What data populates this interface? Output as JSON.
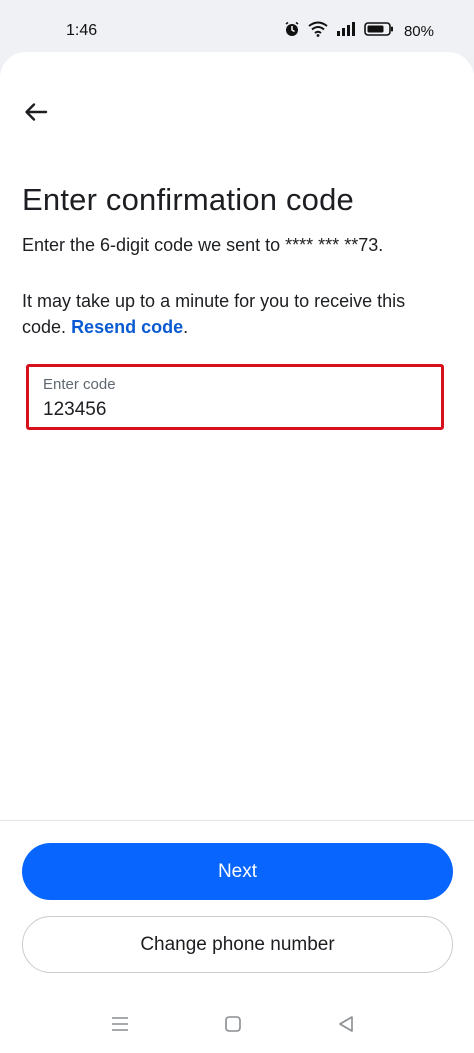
{
  "status_bar": {
    "time": "1:46",
    "battery": "80%",
    "icons": [
      "alarm-icon",
      "wifi-icon",
      "signal-icon",
      "battery-icon"
    ]
  },
  "header": {
    "back_icon": "back-arrow-icon"
  },
  "main": {
    "title": "Enter confirmation code",
    "subtitle": "Enter the 6-digit code we sent to **** *** **73.",
    "info_text": "It may take up to a minute for you to receive this code.",
    "resend_link": "Resend code",
    "resend_suffix": "."
  },
  "code_field": {
    "label": "Enter code",
    "value": "123456",
    "highlight_color": "#d6101c"
  },
  "buttons": {
    "next": "Next",
    "change_phone": "Change phone number"
  },
  "colors": {
    "primary": "#0866ff",
    "link": "#0a5bd3"
  },
  "nav_bar": {
    "icons": [
      "menu-icon",
      "home-icon",
      "back-triangle-icon"
    ]
  }
}
